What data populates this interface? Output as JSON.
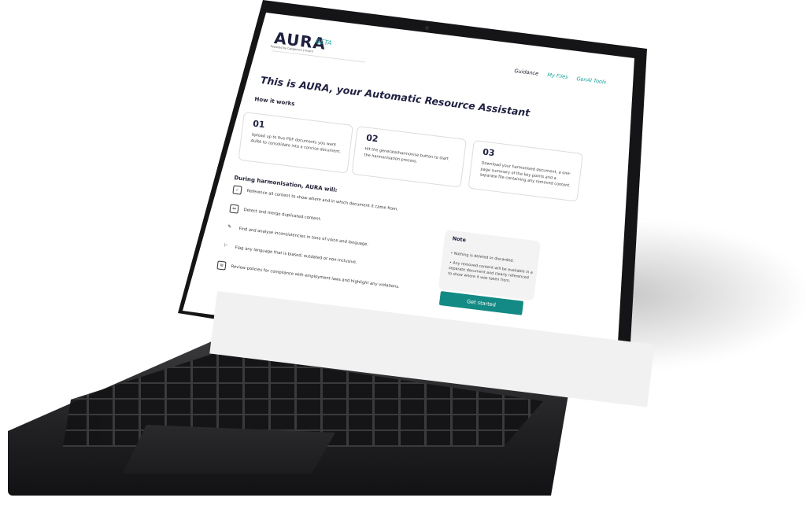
{
  "header": {
    "logo": "AURA",
    "beta": "BETA",
    "powered_by": "Powered by Capgemini | Invent"
  },
  "nav": {
    "items": [
      {
        "label": "Guidance"
      },
      {
        "label": "My Files"
      },
      {
        "label": "GenAI Tools"
      }
    ]
  },
  "main": {
    "title": "This is AURA, your Automatic Resource Assistant",
    "how_it_works_heading": "How it works",
    "steps": [
      {
        "number": "01",
        "text": "Upload up to five PDF documents you want AURA to consolidate into a concise document."
      },
      {
        "number": "02",
        "text": "Hit the generate/harmonise button to start the harmonisation process."
      },
      {
        "number": "03",
        "text": "Download your harmonised document, a one-page summary of the key points and a separate file containing any removed content."
      }
    ],
    "during_heading": "During harmonisation, AURA will:",
    "features": [
      {
        "icon": "reference-icon",
        "text": "Reference all content to show where and in which document it came from."
      },
      {
        "icon": "merge-icon",
        "text": "Detect and merge duplicated content."
      },
      {
        "icon": "analyse-icon",
        "text": "Find and analyse inconsistencies in tone of voice and language."
      },
      {
        "icon": "flag-icon",
        "text": "Flag any language that is biased, outdated or non-inclusive."
      },
      {
        "icon": "policy-icon",
        "text": "Review policies for compliance with employment laws and highlight any violations."
      }
    ]
  },
  "note": {
    "title": "Note",
    "items": [
      "Nothing is deleted or discarded.",
      "Any removed content will be available in a separate document and clearly referenced to show where it was taken from."
    ]
  },
  "cta": {
    "label": "Get started"
  },
  "colors": {
    "accent": "#138a84",
    "teal_text": "#1aa39a",
    "navy": "#1f2040"
  }
}
